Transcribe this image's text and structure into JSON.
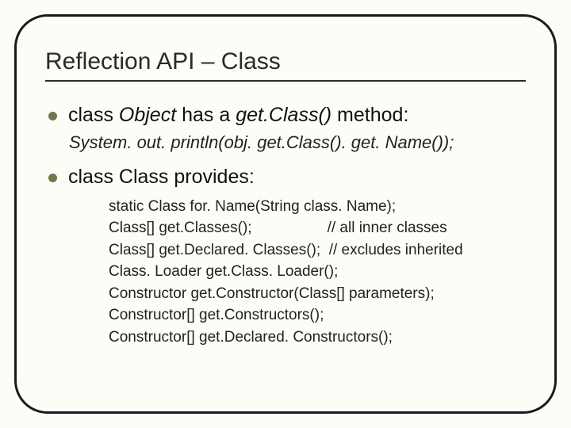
{
  "title": "Reflection API – Class",
  "bullet1": {
    "prefix": "class ",
    "obj": "Object",
    "mid": " has a ",
    "method": "get.Class()",
    "suffix": " method:"
  },
  "subline": "System. out. println(obj. get.Class(). get. Name());",
  "bullet2": "class Class provides:",
  "methods": {
    "l1": "static Class for. Name(String class. Name);",
    "l2a": "Class[] get.Classes();",
    "l2b": "// all inner classes",
    "l3": "Class[] get.Declared. Classes();  // excludes inherited",
    "l4": "Class. Loader get.Class. Loader();",
    "l5": "Constructor get.Constructor(Class[] parameters);",
    "l6": "Constructor[] get.Constructors();",
    "l7": "Constructor[] get.Declared. Constructors();"
  }
}
